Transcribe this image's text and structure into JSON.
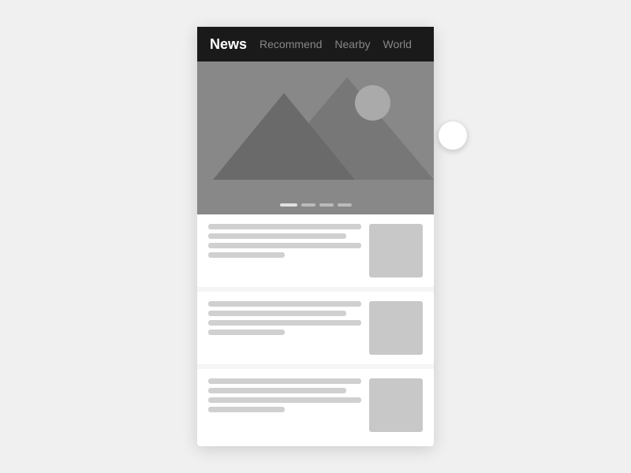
{
  "header": {
    "tabs": [
      {
        "id": "news",
        "label": "News",
        "active": true
      },
      {
        "id": "recommend",
        "label": "Recommend",
        "active": false
      },
      {
        "id": "nearby",
        "label": "Nearby",
        "active": false
      },
      {
        "id": "world",
        "label": "World",
        "active": false
      }
    ]
  },
  "hero": {
    "dots": [
      {
        "active": true
      },
      {
        "active": false
      },
      {
        "active": false
      },
      {
        "active": false
      }
    ]
  },
  "newsList": [
    {
      "lines": [
        "full",
        "wide",
        "full",
        "short"
      ]
    },
    {
      "lines": [
        "full",
        "wide",
        "full",
        "short"
      ]
    },
    {
      "lines": [
        "full",
        "wide",
        "full",
        "short"
      ]
    }
  ],
  "floatButton": {
    "label": ""
  }
}
